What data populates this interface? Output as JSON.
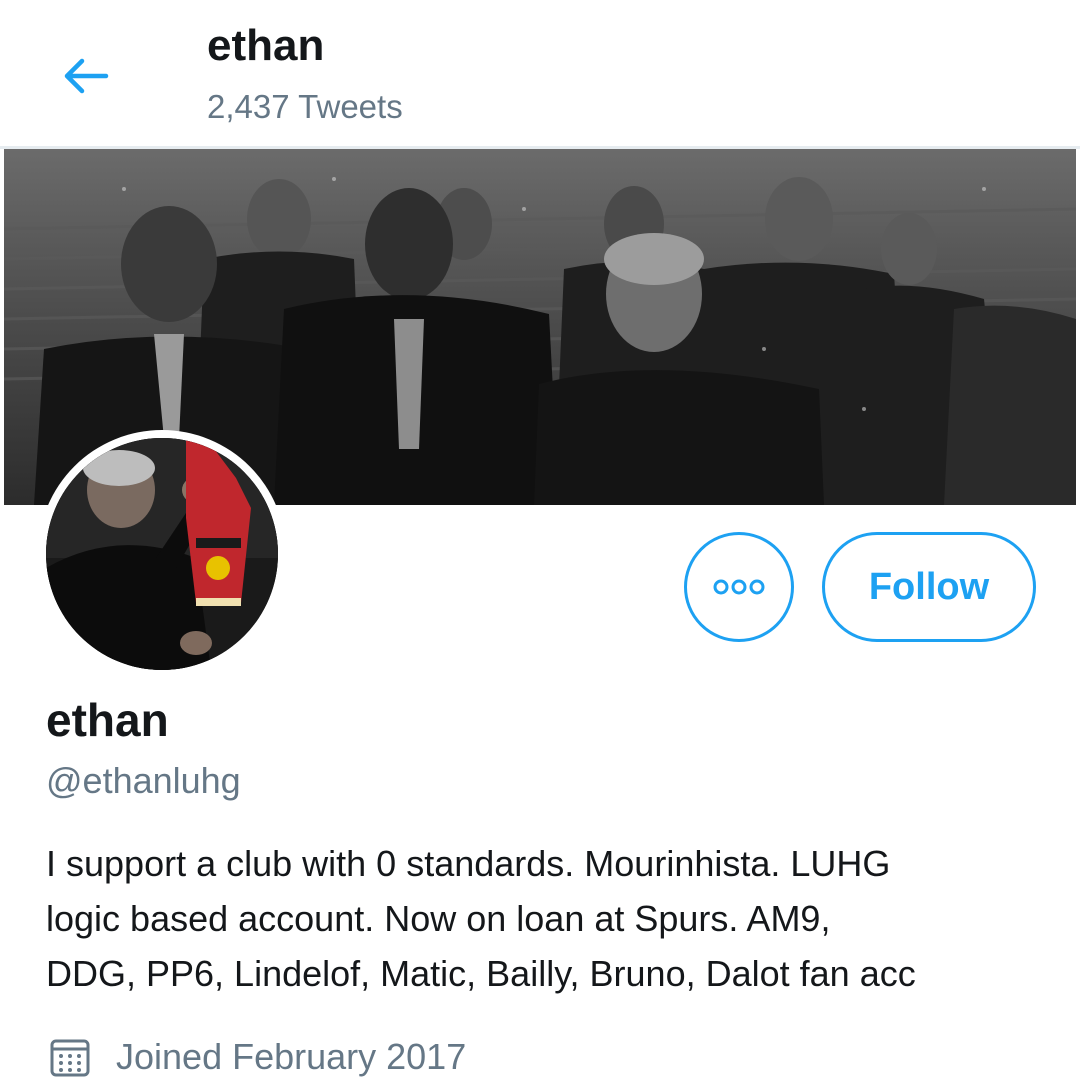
{
  "header": {
    "back_icon": "arrow-left-icon",
    "title": "ethan",
    "tweet_count": "2,437 Tweets"
  },
  "profile": {
    "display_name": "ethan",
    "handle": "@ethanluhg",
    "bio_lines": [
      "I support a club with 0 standards. Mourinhista. LUHG",
      "logic based account. Now on loan at Spurs. AM9,",
      "DDG, PP6, Lindelof, Matic, Bailly, Bruno, Dalot fan acc"
    ],
    "joined_icon": "calendar-icon",
    "joined": "Joined February 2017"
  },
  "actions": {
    "more_icon": "more-dots-icon",
    "follow_label": "Follow"
  },
  "colors": {
    "accent": "#1da1f2",
    "primary_text": "#14171a",
    "secondary_text": "#657786"
  }
}
